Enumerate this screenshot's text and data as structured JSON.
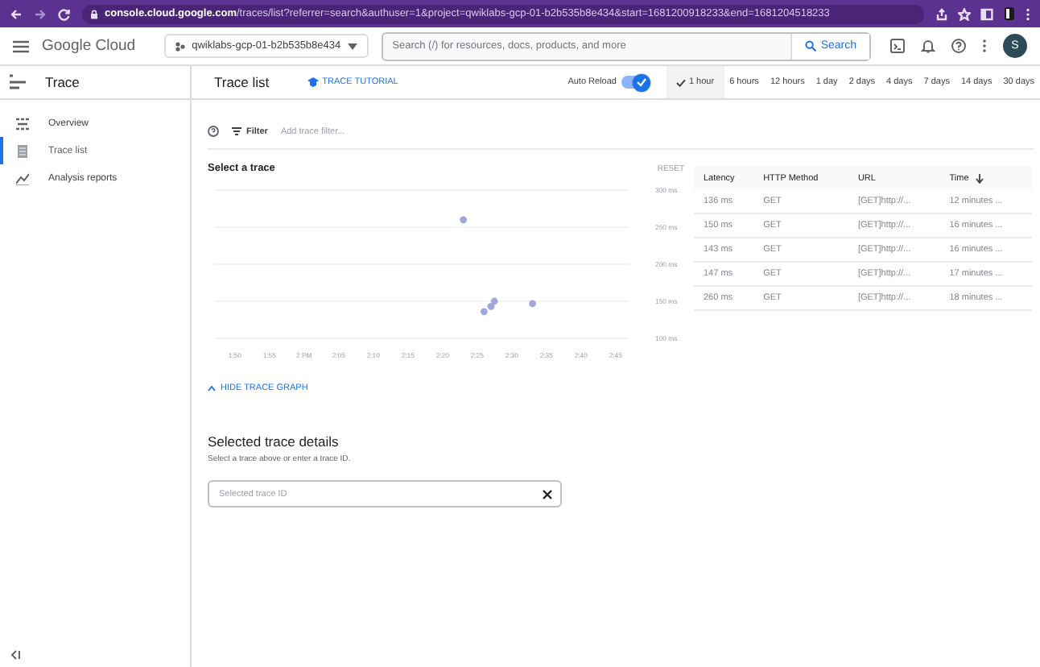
{
  "browser": {
    "url_host": "console.cloud.google.com",
    "url_path": "/traces/list?referrer=search&authuser=1&project=qwiklabs-gcp-01-b2b535b8e434&start=1681200918233&end=1681204518233"
  },
  "header": {
    "product": "Google Cloud",
    "project": "qwiklabs-gcp-01-b2b535b8e434",
    "search_placeholder": "Search (/) for resources, docs, products, and more",
    "search_button": "Search",
    "avatar": "S"
  },
  "sidebar": {
    "title": "Trace",
    "items": [
      {
        "label": "Overview",
        "selected": false
      },
      {
        "label": "Trace list",
        "selected": true
      },
      {
        "label": "Analysis reports",
        "selected": false
      }
    ]
  },
  "toolbar": {
    "title": "Trace list",
    "tutorial": "TRACE TUTORIAL",
    "auto_reload": {
      "label": "Auto Reload",
      "on": true
    },
    "ranges": [
      {
        "label": "1 hour",
        "selected": true
      },
      {
        "label": "6 hours",
        "selected": false
      },
      {
        "label": "12 hours",
        "selected": false
      },
      {
        "label": "1 day",
        "selected": false
      },
      {
        "label": "2 days",
        "selected": false
      },
      {
        "label": "4 days",
        "selected": false
      },
      {
        "label": "7 days",
        "selected": false
      },
      {
        "label": "14 days",
        "selected": false
      },
      {
        "label": "30 days",
        "selected": false
      }
    ]
  },
  "filter": {
    "label": "Filter",
    "placeholder": "Add trace filter..."
  },
  "graph": {
    "title": "Select a trace",
    "reset": "RESET",
    "toggle": "HIDE TRACE GRAPH",
    "chart_data": {
      "type": "scatter",
      "x": [
        2.3833,
        2.4333,
        2.45,
        2.4583,
        2.55
      ],
      "series": [
        {
          "color": "#9fa8da",
          "values": [
            260,
            136,
            143,
            150,
            147
          ]
        }
      ],
      "xlim": [
        1.7833,
        2.7833
      ],
      "ylim": [
        100,
        300
      ],
      "grid": true,
      "xticks": [
        {
          "value": 1.8333,
          "label": "1:50"
        },
        {
          "value": 1.9167,
          "label": "1:55"
        },
        {
          "value": 2,
          "label": "2 PM"
        },
        {
          "value": 2.0833,
          "label": "2:05"
        },
        {
          "value": 2.1667,
          "label": "2:10"
        },
        {
          "value": 2.25,
          "label": "2:15"
        },
        {
          "value": 2.3333,
          "label": "2:20"
        },
        {
          "value": 2.4167,
          "label": "2:25"
        },
        {
          "value": 2.5,
          "label": "2:30"
        },
        {
          "value": 2.5833,
          "label": "2:35"
        },
        {
          "value": 2.6667,
          "label": "2:40"
        },
        {
          "value": 2.75,
          "label": "2:45"
        }
      ],
      "yticks": [
        {
          "value": 100,
          "label": "100 ms"
        },
        {
          "value": 150,
          "label": "150 ms"
        },
        {
          "value": 200,
          "label": "200 ms"
        },
        {
          "value": 250,
          "label": "250 ms"
        },
        {
          "value": 300,
          "label": "300 ms"
        }
      ]
    }
  },
  "table": {
    "columns": [
      {
        "label": "Latency",
        "sorted": false
      },
      {
        "label": "HTTP Method",
        "sorted": false
      },
      {
        "label": "URL",
        "sorted": false
      },
      {
        "label": "Time",
        "sorted": true
      }
    ],
    "rows": [
      [
        "136 ms",
        "GET",
        "[GET]http://...",
        "12 minutes ..."
      ],
      [
        "150 ms",
        "GET",
        "[GET]http://...",
        "16 minutes ..."
      ],
      [
        "143 ms",
        "GET",
        "[GET]http://...",
        "16 minutes ..."
      ],
      [
        "147 ms",
        "GET",
        "[GET]http://...",
        "17 minutes ..."
      ],
      [
        "260 ms",
        "GET",
        "[GET]http://...",
        "18 minutes ..."
      ]
    ]
  },
  "details": {
    "title": "Selected trace details",
    "hint": "Select a trace above or enter a trace ID.",
    "field_placeholder": "Selected trace ID"
  }
}
